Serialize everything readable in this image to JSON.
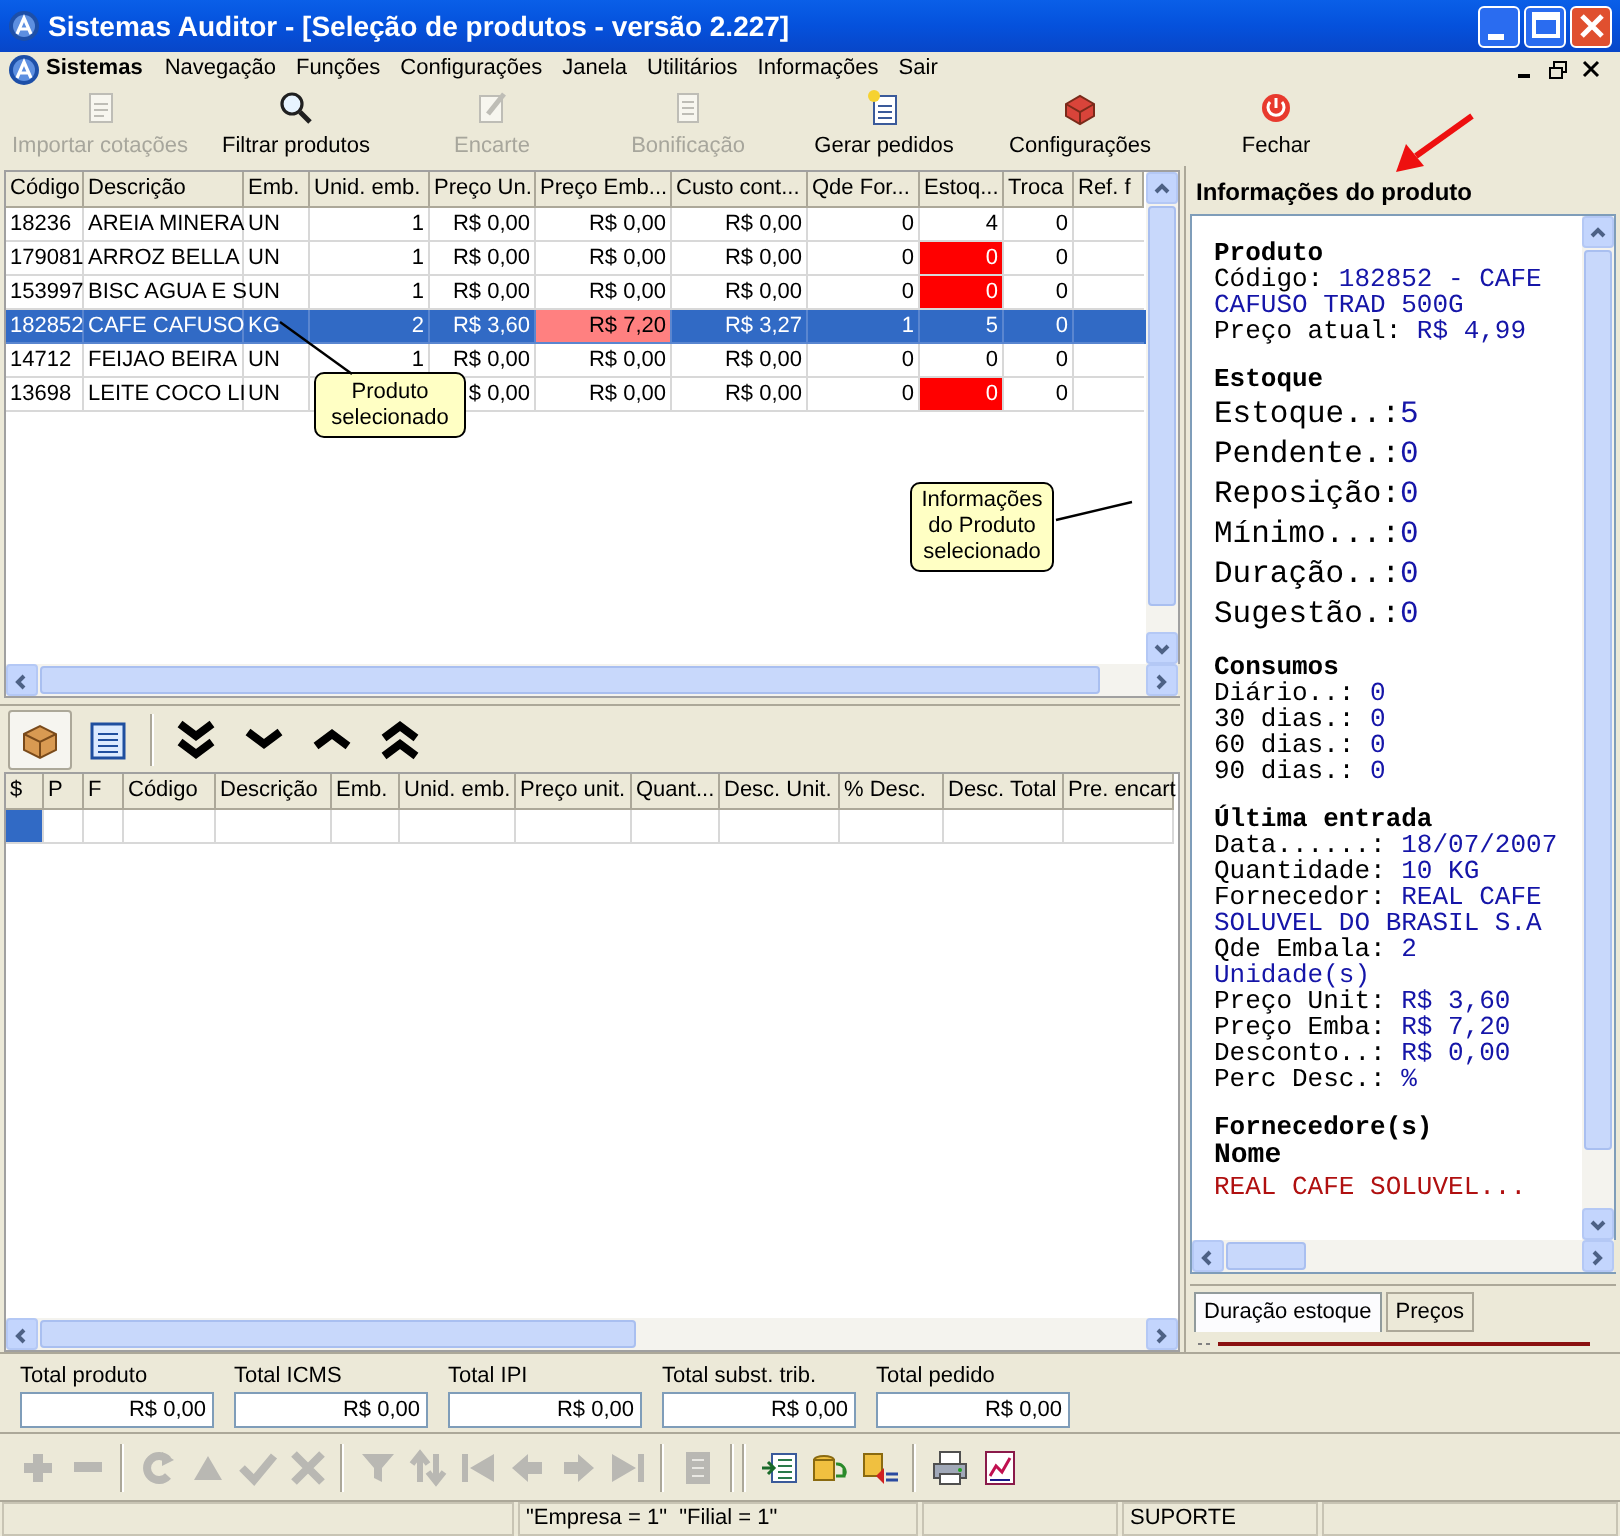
{
  "window": {
    "title": "Sistemas Auditor - [Seleção de produtos - versão 2.227]"
  },
  "menu_bar": [
    {
      "label": "Sistemas",
      "kind": "app"
    },
    {
      "label": "Navegação",
      "kind": "menu"
    },
    {
      "label": "Funções",
      "kind": "menu"
    },
    {
      "label": "Configurações",
      "kind": "menu"
    },
    {
      "label": "Janela",
      "kind": "menu"
    },
    {
      "label": "Utilitários",
      "kind": "menu"
    },
    {
      "label": "Informações",
      "kind": "menu"
    },
    {
      "label": "Sair",
      "kind": "menu"
    }
  ],
  "toolbar": [
    {
      "label": "Importar cotações",
      "disabled": true
    },
    {
      "label": "Filtrar produtos",
      "disabled": false
    },
    {
      "label": "Encarte",
      "disabled": true
    },
    {
      "label": "Bonificação",
      "disabled": true
    },
    {
      "label": "Gerar pedidos",
      "disabled": false
    },
    {
      "label": "Configurações",
      "disabled": false
    },
    {
      "label": "Fechar",
      "disabled": false
    }
  ],
  "products_table": {
    "columns": [
      "Código",
      "Descrição",
      "Emb.",
      "Unid. emb.",
      "Preço Un.",
      "Preço Emb...",
      "Custo cont...",
      "Qde For...",
      "Estoq...",
      "Troca",
      "Ref. f"
    ],
    "rows": [
      {
        "cells": [
          "18236",
          "AREIA MINERA",
          "UN",
          "1",
          "R$ 0,00",
          "R$ 0,00",
          "R$ 0,00",
          "0",
          "4",
          "0"
        ],
        "selected": false,
        "stock_alert": false,
        "price_alert": false
      },
      {
        "cells": [
          "179081",
          "ARROZ BELLA",
          "UN",
          "1",
          "R$ 0,00",
          "R$ 0,00",
          "R$ 0,00",
          "0",
          "0",
          "0"
        ],
        "selected": false,
        "stock_alert": true,
        "price_alert": false
      },
      {
        "cells": [
          "153997",
          "BISC AGUA E S",
          "UN",
          "1",
          "R$ 0,00",
          "R$ 0,00",
          "R$ 0,00",
          "0",
          "0",
          "0"
        ],
        "selected": false,
        "stock_alert": true,
        "price_alert": false
      },
      {
        "cells": [
          "182852",
          "CAFE CAFUSO",
          "KG",
          "2",
          "R$ 3,60",
          "R$ 7,20",
          "R$ 3,27",
          "1",
          "5",
          "0"
        ],
        "selected": true,
        "stock_alert": false,
        "price_alert": true
      },
      {
        "cells": [
          "14712",
          "FEIJAO BEIRA",
          "UN",
          "1",
          "R$ 0,00",
          "R$ 0,00",
          "R$ 0,00",
          "0",
          "0",
          "0"
        ],
        "selected": false,
        "stock_alert": false,
        "price_alert": false
      },
      {
        "cells": [
          "13698",
          "LEITE COCO LI",
          "UN",
          null,
          "$ 0,00",
          "R$ 0,00",
          "R$ 0,00",
          "0",
          "0",
          "0"
        ],
        "selected": false,
        "stock_alert": true,
        "price_alert": false
      }
    ]
  },
  "callouts": [
    {
      "text": "Produto selecionado"
    },
    {
      "text": "Informações do Produto selecionado"
    }
  ],
  "items_toolbar": [
    {
      "pressed": true
    },
    {
      "pressed": false
    },
    {
      "pressed": false
    },
    {
      "pressed": false
    },
    {
      "pressed": false
    },
    {
      "pressed": false
    }
  ],
  "items_table": {
    "columns": [
      "$",
      "P",
      "F",
      "Código",
      "Descrição",
      "Emb.",
      "Unid. emb.",
      "Preço unit.",
      "Quant...",
      "Desc. Unit.",
      "% Desc.",
      "Desc. Total",
      "Pre. encart"
    ]
  },
  "totals": [
    {
      "label": "Total produto",
      "value": "R$ 0,00"
    },
    {
      "label": "Total ICMS",
      "value": "R$ 0,00"
    },
    {
      "label": "Total IPI",
      "value": "R$ 0,00"
    },
    {
      "label": "Total subst. trib.",
      "value": "R$ 0,00"
    },
    {
      "label": "Total pedido",
      "value": "R$ 0,00"
    }
  ],
  "action_bar": [
    {
      "disabled": true
    },
    {
      "disabled": true
    },
    {
      "disabled": true
    },
    {
      "disabled": true
    },
    {
      "disabled": true
    },
    {
      "disabled": true
    },
    {
      "disabled": true
    },
    {
      "disabled": true
    },
    {
      "disabled": true
    },
    {
      "disabled": true
    },
    {
      "disabled": true
    },
    {
      "disabled": true
    },
    {
      "disabled": true
    },
    {
      "disabled": false
    },
    {
      "disabled": false
    },
    {
      "disabled": false
    },
    {
      "disabled": false
    },
    {
      "disabled": false
    }
  ],
  "info_panel": {
    "title": "Informações do produto",
    "sections": [
      {
        "kind": "fields",
        "heading": "Produto",
        "large": false,
        "lines": [
          {
            "label": "Código: ",
            "value": "182852 - CAFE CAFUSO TRAD 500G"
          },
          {
            "label": "Preço atual: ",
            "value": "R$ 4,99"
          }
        ]
      },
      {
        "kind": "fields",
        "heading": "Estoque",
        "large": true,
        "lines": [
          {
            "label": "Estoque..:",
            "value": "5"
          },
          {
            "label": "Pendente.:",
            "value": "0"
          },
          {
            "label": "Reposição:",
            "value": "0"
          },
          {
            "label": "Mínimo...:",
            "value": "0"
          },
          {
            "label": "Duração..:",
            "value": "0"
          },
          {
            "label": "Sugestão.:",
            "value": "0"
          }
        ]
      },
      {
        "kind": "fields",
        "heading": "Consumos",
        "large": false,
        "lines": [
          {
            "label": "Diário..: ",
            "value": "0"
          },
          {
            "label": "30 dias.: ",
            "value": "0"
          },
          {
            "label": "60 dias.: ",
            "value": "0"
          },
          {
            "label": "90 dias.: ",
            "value": "0"
          }
        ]
      },
      {
        "kind": "fields",
        "heading": "Última entrada",
        "large": false,
        "lines": [
          {
            "label": "Data......: ",
            "value": "18/07/2007"
          },
          {
            "label": "Quantidade: ",
            "value": "10 KG"
          },
          {
            "label": "Fornecedor: ",
            "value": "REAL CAFE SOLUVEL DO BRASIL S.A"
          },
          {
            "label": "Qde Embala: ",
            "value": "2 Unidade(s)"
          },
          {
            "label": "Preço Unit: ",
            "value": "R$ 3,60"
          },
          {
            "label": "Preço Emba: ",
            "value": "R$ 7,20"
          },
          {
            "label": "Desconto..: ",
            "value": "R$ 0,00"
          },
          {
            "label": "Perc Desc.: ",
            "value": "%"
          }
        ]
      },
      {
        "kind": "list",
        "heading": "Fornecedore(s)",
        "column": "Nome",
        "rows": [
          "REAL CAFE SOLUVEL..."
        ]
      }
    ],
    "tabs": [
      {
        "label": "Duração estoque",
        "selected": true
      },
      {
        "label": "Preços",
        "selected": false
      }
    ]
  },
  "status_bar": {
    "filters": "\"Empresa = 1\"  \"Filial = 1\"",
    "user": "SUPORTE"
  }
}
